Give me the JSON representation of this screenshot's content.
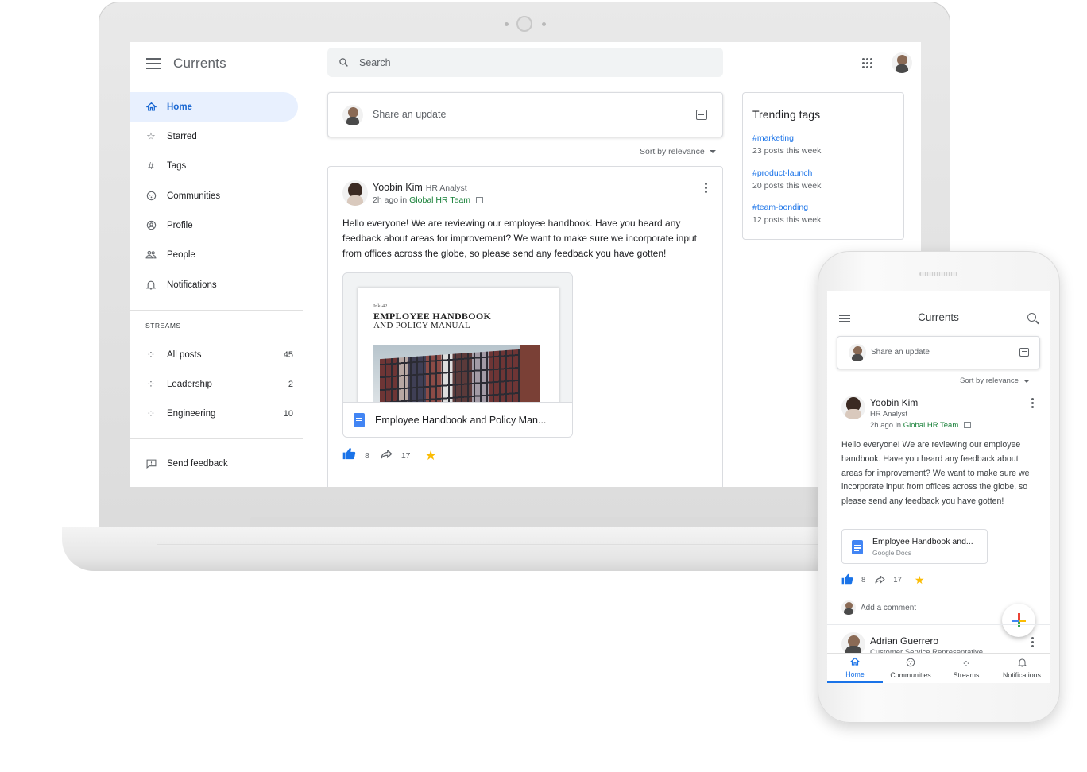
{
  "app": {
    "title": "Currents"
  },
  "search": {
    "placeholder": "Search"
  },
  "nav": {
    "items": [
      {
        "label": "Home",
        "icon": "home-icon"
      },
      {
        "label": "Starred",
        "icon": "star-icon"
      },
      {
        "label": "Tags",
        "icon": "hash-icon"
      },
      {
        "label": "Communities",
        "icon": "communities-icon"
      },
      {
        "label": "Profile",
        "icon": "profile-icon"
      },
      {
        "label": "People",
        "icon": "people-icon"
      },
      {
        "label": "Notifications",
        "icon": "bell-icon"
      }
    ],
    "streams_label": "STREAMS",
    "streams": [
      {
        "label": "All posts",
        "count": "45"
      },
      {
        "label": "Leadership",
        "count": "2"
      },
      {
        "label": "Engineering",
        "count": "10"
      }
    ],
    "feedback": "Send feedback"
  },
  "share": {
    "placeholder": "Share an update"
  },
  "sort": {
    "label": "Sort by relevance"
  },
  "post": {
    "author": "Yoobin Kim",
    "role": "HR Analyst",
    "time": "2h ago in",
    "community": "Global HR Team",
    "body": "Hello everyone! We are reviewing our employee handbook. Have you heard any feedback about areas for improvement? We want to make sure we incorporate input from offices across the globe, so please send any feedback you have gotten!",
    "attachment": {
      "brand": "Ink-42",
      "title_line1": "EMPLOYEE HANDBOOK",
      "title_line2": "AND POLICY MANUAL",
      "title": "Employee Handbook and Policy Man...",
      "title_short": "Employee Handbook and...",
      "source": "Google Docs"
    },
    "likes": "8",
    "shares": "17"
  },
  "trending": {
    "title": "Trending tags",
    "tags": [
      {
        "tag": "#marketing",
        "count": "23 posts this week"
      },
      {
        "tag": "#product-launch",
        "count": "20 posts this week"
      },
      {
        "tag": "#team-bonding",
        "count": "12 posts this week"
      }
    ]
  },
  "phone": {
    "comment_placeholder": "Add a comment",
    "next_post_author": "Adrian Guerrero",
    "next_post_role": "Customer Service Representative",
    "bottom_nav": [
      {
        "label": "Home"
      },
      {
        "label": "Communities"
      },
      {
        "label": "Streams"
      },
      {
        "label": "Notifications"
      }
    ]
  },
  "colors": {
    "accent": "#1a73e8",
    "community": "#188038",
    "star": "#fbbc04",
    "active_nav_bg": "#e8f0fe"
  }
}
